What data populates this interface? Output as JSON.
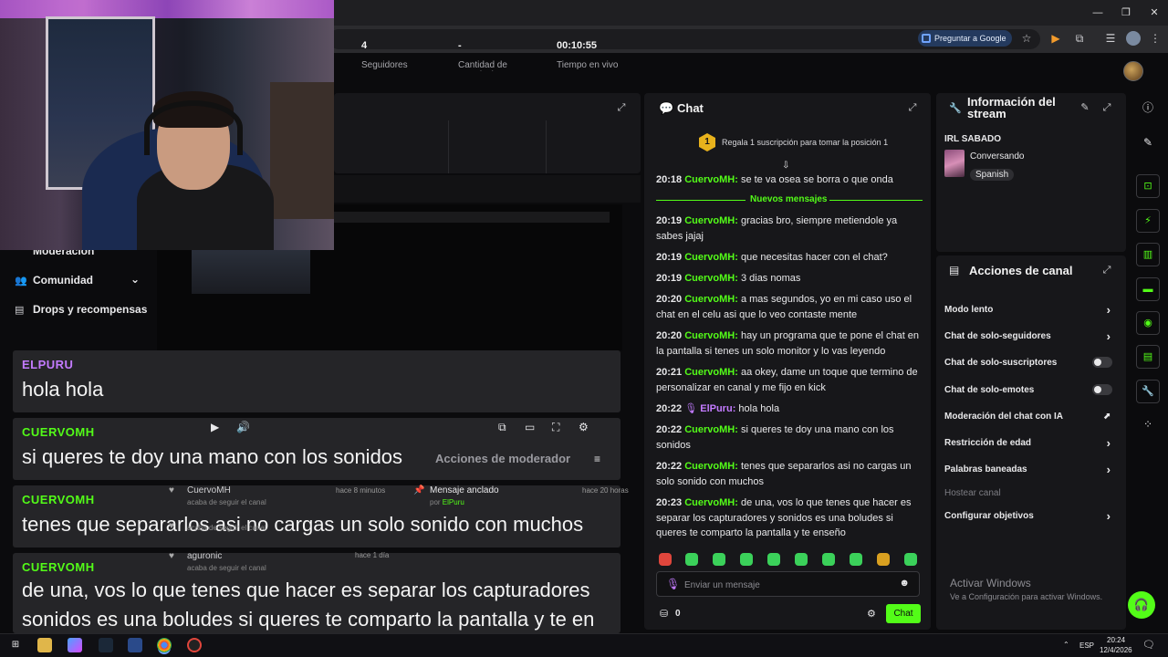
{
  "browser": {
    "ask_google": "Preguntar a Google",
    "window_controls": [
      "—",
      "❐",
      "✕"
    ]
  },
  "stats": [
    {
      "value": "4",
      "label": "Seguidores"
    },
    {
      "value": "-",
      "label": "Cantidad de suscripciones"
    },
    {
      "value": "00:10:55",
      "label": "Tiempo en vivo"
    }
  ],
  "left_nav": {
    "items": [
      {
        "label": "Moderación",
        "icon": "shield-icon"
      },
      {
        "label": "Comunidad",
        "icon": "people-icon"
      },
      {
        "label": "Drops y recompensas",
        "icon": "gift-icon"
      }
    ]
  },
  "overlay_chat": [
    {
      "user": "ELPURU",
      "color": "#c37bff",
      "text": "hola hola"
    },
    {
      "user": "CUERVOMH",
      "color": "#53fc18",
      "text": "si queres te doy una mano con los sonidos"
    },
    {
      "user": "CUERVOMH",
      "color": "#53fc18",
      "text": "tenes que separarlos asi no cargas un solo sonido con muchos"
    },
    {
      "user": "CUERVOMH",
      "color": "#53fc18",
      "text": "de una, vos lo que tenes que hacer es separar los capturadores",
      "text2": "sonidos es una boludes si queres te comparto la pantalla y te en"
    }
  ],
  "moderator_actions": "Acciones de moderador",
  "followers": [
    {
      "name": "CuervoMH",
      "sub": "acaba de seguir el canal",
      "time": "hace 8 minutos"
    },
    {
      "name": "",
      "sub": "acaba de seguir el canal",
      "time": ""
    },
    {
      "name": "aguronic",
      "sub": "acaba de seguir el canal",
      "time": "hace 1 día"
    }
  ],
  "pinned": {
    "title": "Mensaje anclado",
    "by": "por",
    "user": "ElPuru",
    "time": "hace 20 horas"
  },
  "chat": {
    "title": "Chat",
    "sub_rank": "1",
    "sub_banner": "Regala 1 suscripción para tomar la posición 1",
    "new_messages": "Nuevos mensajes",
    "messages": [
      {
        "time": "20:18",
        "user": "CuervoMH",
        "text": "se te va osea se borra o que onda"
      },
      {
        "time": "20:19",
        "user": "CuervoMH",
        "text": "gracias bro, siempre metiendole ya sabes jajaj"
      },
      {
        "time": "20:19",
        "user": "CuervoMH",
        "text": "que necesitas hacer con el chat?"
      },
      {
        "time": "20:19",
        "user": "CuervoMH",
        "text": "3 dias nomas"
      },
      {
        "time": "20:20",
        "user": "CuervoMH",
        "text": "a mas segundos, yo en mi caso uso el chat en el celu asi que lo veo contaste mente"
      },
      {
        "time": "20:20",
        "user": "CuervoMH",
        "text": "hay un programa que te pone el chat en la pantalla si tenes un solo monitor y lo vas leyendo"
      },
      {
        "time": "20:21",
        "user": "CuervoMH",
        "text": "aa okey, dame un toque que termino de personalizar en canal y me fijo en kick"
      },
      {
        "time": "20:22",
        "user": "ElPuru",
        "text": "hola hola"
      },
      {
        "time": "20:22",
        "user": "CuervoMH",
        "text": "si queres te doy una mano con los sonidos"
      },
      {
        "time": "20:22",
        "user": "CuervoMH",
        "text": "tenes que separarlos asi no cargas un solo sonido con muchos"
      },
      {
        "time": "20:23",
        "user": "CuervoMH",
        "text": "de una, vos lo que tenes que hacer es separar los capturadores y sonidos es una boludes si queres te comparto la pantalla y te enseño"
      }
    ],
    "input_placeholder": "Enviar un mensaje",
    "points": "0",
    "send_label": "Chat"
  },
  "info": {
    "title_line1": "Información del",
    "title_line2": "stream",
    "stream_title": "IRL SABADO",
    "category": "Conversando",
    "language": "Spanish"
  },
  "actions": {
    "title": "Acciones de canal",
    "items": [
      {
        "label": "Modo lento",
        "kind": "chevron"
      },
      {
        "label": "Chat de solo-seguidores",
        "kind": "chevron"
      },
      {
        "label": "Chat de solo-suscriptores",
        "kind": "toggle"
      },
      {
        "label": "Chat de solo-emotes",
        "kind": "toggle"
      },
      {
        "label": "Moderación del chat con IA",
        "kind": "external"
      },
      {
        "label": "Restricción de edad",
        "kind": "chevron"
      },
      {
        "label": "Palabras baneadas",
        "kind": "chevron"
      },
      {
        "label": "Hostear canal",
        "kind": "disabled"
      },
      {
        "label": "Configurar objetivos",
        "kind": "chevron"
      }
    ]
  },
  "windows_activation": {
    "heading": "Activar Windows",
    "sub": "Ve a Configuración para activar Windows."
  },
  "taskbar": {
    "lang": "ESP",
    "time": "20:24",
    "date": "12/4/2026"
  },
  "colors": {
    "kick_green": "#53fc18",
    "elpuru_purple": "#c37bff",
    "panel_bg": "#17171a"
  }
}
